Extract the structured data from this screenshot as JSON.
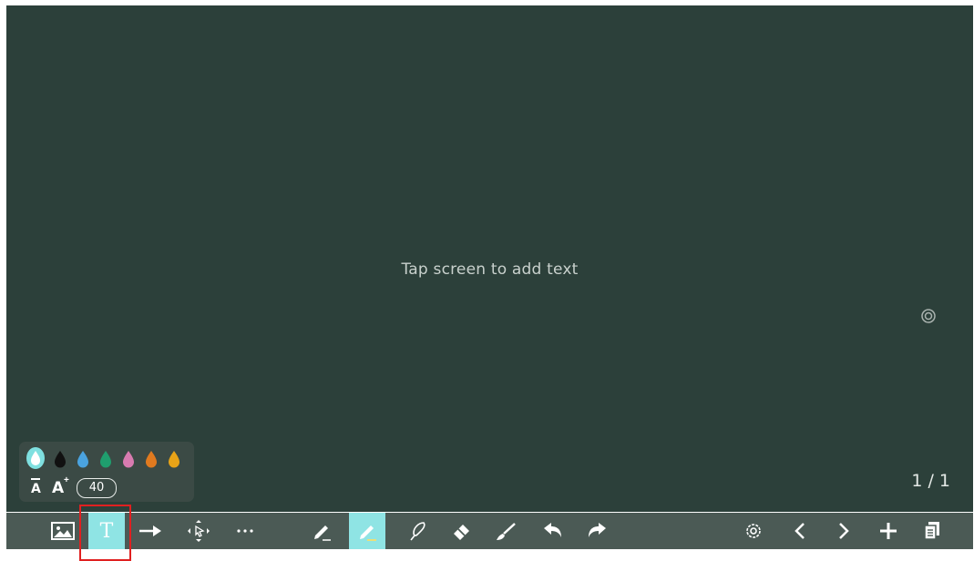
{
  "canvas": {
    "hint": "Tap screen to add text",
    "page_indicator": "1 / 1",
    "background_color": "#2c403a"
  },
  "text_palette": {
    "colors": [
      {
        "name": "white",
        "hex": "#ffffff",
        "selected": true
      },
      {
        "name": "black",
        "hex": "#111111",
        "selected": false
      },
      {
        "name": "blue",
        "hex": "#4aa3df",
        "selected": false
      },
      {
        "name": "green",
        "hex": "#1f9e6e",
        "selected": false
      },
      {
        "name": "pink",
        "hex": "#d87bb0",
        "selected": false
      },
      {
        "name": "orange",
        "hex": "#e07a1f",
        "selected": false
      },
      {
        "name": "yellow",
        "hex": "#e8a317",
        "selected": false
      }
    ],
    "font_decrease_label": "A",
    "font_increase_label": "A",
    "font_size": "40"
  },
  "toolbar": {
    "left_tools": [
      "image-icon",
      "text-icon",
      "arrow-icon",
      "move-select-icon",
      "more-icon"
    ],
    "center_tools": [
      "pen-icon",
      "highlighter-icon",
      "lasso-icon",
      "eraser-icon",
      "brush-icon",
      "undo-icon",
      "redo-icon"
    ],
    "right_tools": [
      "settings-icon",
      "prev-page-icon",
      "next-page-icon",
      "add-page-icon",
      "pages-icon"
    ],
    "text_tool_label": "T",
    "active_color": "#8fe4e4"
  }
}
